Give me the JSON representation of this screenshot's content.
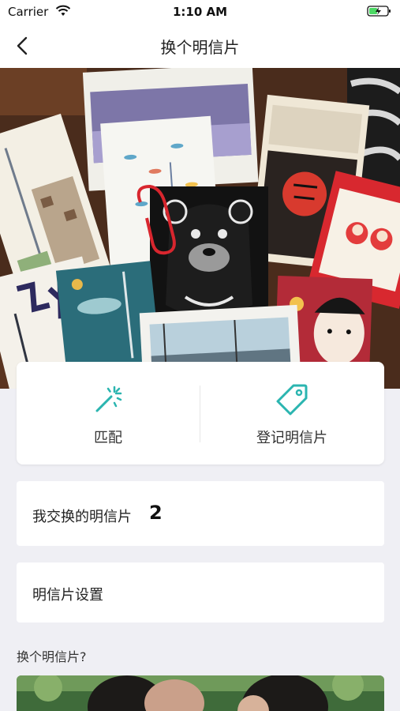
{
  "status_bar": {
    "carrier": "Carrier",
    "time": "1:10 AM",
    "wifi_icon": "wifi-icon",
    "battery_icon": "battery-charging-icon"
  },
  "nav": {
    "title": "换个明信片",
    "back_icon": "chevron-left-icon"
  },
  "hero": {
    "image": "postcards-collage-photo"
  },
  "actions": [
    {
      "label": "匹配",
      "icon": "magic-wand-icon"
    },
    {
      "label": "登记明信片",
      "icon": "tag-icon"
    }
  ],
  "rows": {
    "exchanged_label": "我交换的明信片",
    "exchanged_count": "2",
    "settings_label": "明信片设置"
  },
  "section": {
    "title": "换个明信片?",
    "image": "people-photo"
  },
  "colors": {
    "accent": "#2bb5b0",
    "background": "#efeff4",
    "card": "#ffffff"
  }
}
